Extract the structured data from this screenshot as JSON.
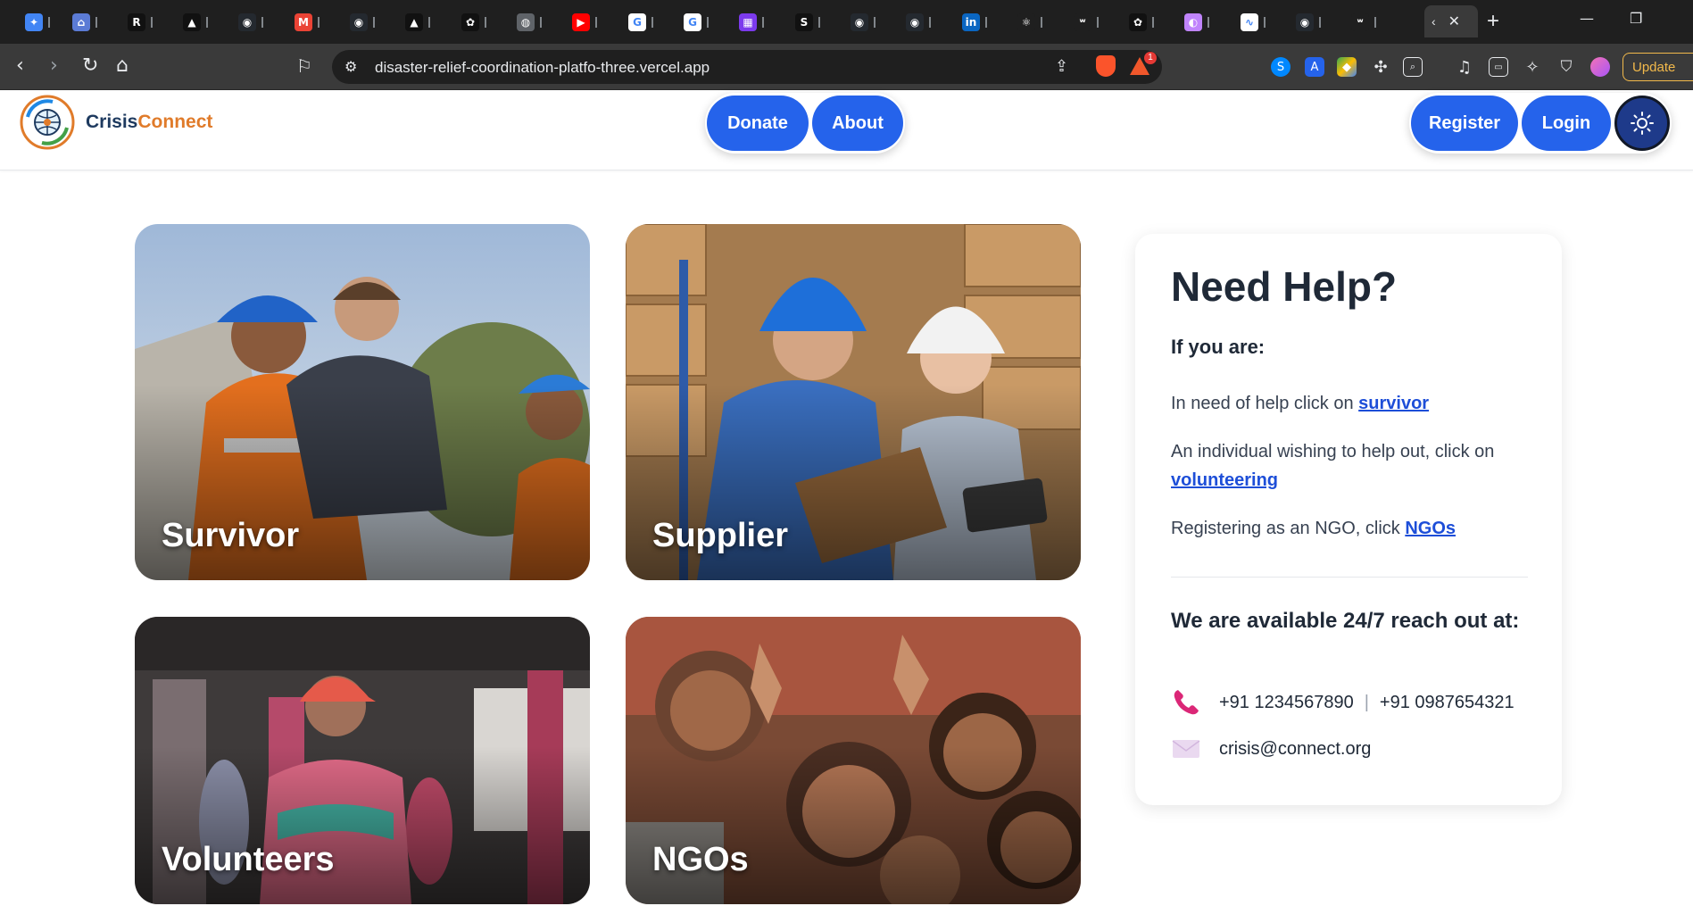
{
  "browser": {
    "tabs": [
      {
        "icon": "gemini-icon",
        "color": "#4285f4",
        "glyph": "✦"
      },
      {
        "icon": "home-shield-icon",
        "color": "#5b7bd5",
        "glyph": "⌂"
      },
      {
        "icon": "r-icon",
        "color": "#111111",
        "glyph": "R"
      },
      {
        "icon": "triangle-icon",
        "color": "#111111",
        "glyph": "▲"
      },
      {
        "icon": "github-icon",
        "color": "#24292f",
        "glyph": "◉"
      },
      {
        "icon": "gmail-icon",
        "color": "#ea4335",
        "glyph": "M"
      },
      {
        "icon": "github-icon",
        "color": "#24292f",
        "glyph": "◉"
      },
      {
        "icon": "triangle-icon",
        "color": "#111111",
        "glyph": "▲"
      },
      {
        "icon": "openai-icon",
        "color": "#111111",
        "glyph": "✿"
      },
      {
        "icon": "globe-icon",
        "color": "#5f6368",
        "glyph": "◍"
      },
      {
        "icon": "youtube-icon",
        "color": "#ff0000",
        "glyph": "▶"
      },
      {
        "icon": "google-icon",
        "color": "#ffffff",
        "glyph": "G"
      },
      {
        "icon": "google-icon",
        "color": "#ffffff",
        "glyph": "G"
      },
      {
        "icon": "calendar-icon",
        "color": "#7c3aed",
        "glyph": "▦"
      },
      {
        "icon": "s-icon",
        "color": "#111111",
        "glyph": "S"
      },
      {
        "icon": "github-icon",
        "color": "#24292f",
        "glyph": "◉"
      },
      {
        "icon": "github-icon",
        "color": "#24292f",
        "glyph": "◉"
      },
      {
        "icon": "linkedin-icon",
        "color": "#0a66c2",
        "glyph": "in"
      },
      {
        "icon": "react-icon",
        "color": "#1f1f1f",
        "glyph": "⚛"
      },
      {
        "icon": "mw-icon",
        "color": "#1f1f1f",
        "glyph": "ʷ"
      },
      {
        "icon": "openai-icon",
        "color": "#111111",
        "glyph": "✿"
      },
      {
        "icon": "gradient-icon",
        "color": "#c084fc",
        "glyph": "◐"
      },
      {
        "icon": "wave-icon",
        "color": "#ffffff",
        "glyph": "∿"
      },
      {
        "icon": "github-icon",
        "color": "#24292f",
        "glyph": "◉"
      },
      {
        "icon": "mw-icon",
        "color": "#1f1f1f",
        "glyph": "ʷ"
      }
    ],
    "active_tab_glyph": "‹",
    "url": "disaster-relief-coordination-platfo-three.vercel.app",
    "update_label": "Update",
    "brave_badge": "1"
  },
  "header": {
    "brand_part1": "Crisis",
    "brand_part2": "Connect",
    "nav": {
      "donate": "Donate",
      "about": "About"
    },
    "auth": {
      "register": "Register",
      "login": "Login"
    }
  },
  "cards": {
    "survivor": "Survivor",
    "supplier": "Supplier",
    "volunteers": "Volunteers",
    "ngos": "NGOs"
  },
  "help": {
    "title": "Need Help?",
    "subtitle": "If you are:",
    "line1_text": "In need of help click on ",
    "line1_link": "survivor",
    "line2_text": "An individual wishing to help out, click on ",
    "line2_link": "volunteering",
    "line3_text": "Registering as an NGO, click ",
    "line3_link": "NGOs",
    "available": "We are available 24/7 reach out at:",
    "phone1": "+91 1234567890",
    "phone_sep": "|",
    "phone2": "+91 0987654321",
    "email": "crisis@connect.org"
  },
  "colors": {
    "primary": "#2563eb",
    "brand_dark": "#1e3a5f",
    "brand_orange": "#e07b2a",
    "link": "#1d4ed8",
    "phone_icon": "#db2777"
  }
}
